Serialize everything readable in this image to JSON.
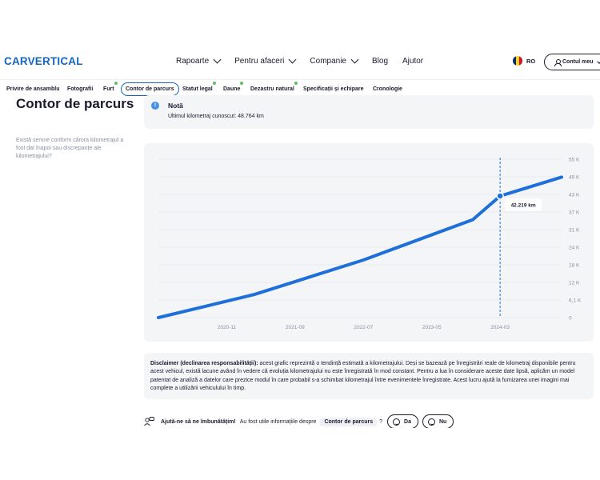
{
  "header": {
    "logo": "CARVERTICAL",
    "nav": [
      {
        "label": "Rapoarte",
        "dropdown": true
      },
      {
        "label": "Pentru afaceri",
        "dropdown": true
      },
      {
        "label": "Companie",
        "dropdown": true
      },
      {
        "label": "Blog",
        "dropdown": false
      },
      {
        "label": "Ajutor",
        "dropdown": false
      }
    ],
    "lang": "RO",
    "account": "Contul meu"
  },
  "tabs": [
    {
      "label": "Privire de ansamblu",
      "dot": false,
      "active": false
    },
    {
      "label": "Fotografii",
      "dot": false,
      "active": false
    },
    {
      "label": "Furt",
      "dot": true,
      "active": false
    },
    {
      "label": "Contor de parcurs",
      "dot": false,
      "active": true
    },
    {
      "label": "Statut legal",
      "dot": true,
      "active": false
    },
    {
      "label": "Daune",
      "dot": true,
      "active": false
    },
    {
      "label": "Dezastru natural",
      "dot": true,
      "active": false
    },
    {
      "label": "Specificații și echipare",
      "dot": false,
      "active": false
    },
    {
      "label": "Cronologie",
      "dot": false,
      "active": false
    }
  ],
  "section": {
    "title": "Contor de parcurs",
    "description": "Există semne conform cărora kilometrajul a fost dat înapoi sau discrepanțe ale kilometrajului?"
  },
  "note": {
    "title": "Notă",
    "text": "Ultimul kilometraj cunoscut: 48.764 km"
  },
  "chart_data": {
    "type": "line",
    "x": [
      "2020-01",
      "2021-03",
      "2022-07",
      "2023-11",
      "2024-03",
      "2024-12"
    ],
    "series": [
      {
        "values": [
          0,
          8000,
          20000,
          34000,
          42219,
          48764
        ]
      }
    ],
    "xticks": [
      "2020-11",
      "2021-09",
      "2022-07",
      "2023-05",
      "2024-03"
    ],
    "yticks": [
      "0",
      "6,1 K",
      "12 K",
      "18 K",
      "24 K",
      "31 K",
      "37 K",
      "43 K",
      "49 K",
      "55 K"
    ],
    "ylim": [
      0,
      55000
    ],
    "grid": true,
    "marker": {
      "x": "2024-03",
      "label": "42.219 km"
    },
    "colors": {
      "line": "#1e6fd9",
      "marker_line": "#1e6fd9"
    }
  },
  "disclaimer": {
    "bold": "Disclaimer (declinarea responsabilității):",
    "text": " acest grafic reprezintă o tendință estimată a kilometrajului. Deși se bazează pe înregistrări reale de kilometraj disponibile pentru acest vehicul, există lacune având în vedere că evoluția kilometrajului nu este înregistrată în mod constant. Pentru a lua în considerare aceste date lipsă, aplicăm un model patentat de analiză a datelor care prezice modul în care probabil s-a schimbat kilometrajul între evenimentele înregistrate. Acest lucru ajută la furnizarea unei imagini mai complete a utilizării vehiculului în timp."
  },
  "feedback": {
    "question": "Ajută-ne să ne îmbunătățim!",
    "sub": "Au fost utile informațiile despre",
    "chip": "Contor de parcurs",
    "qmark": "?",
    "yes": "Da",
    "no": "Nu"
  }
}
